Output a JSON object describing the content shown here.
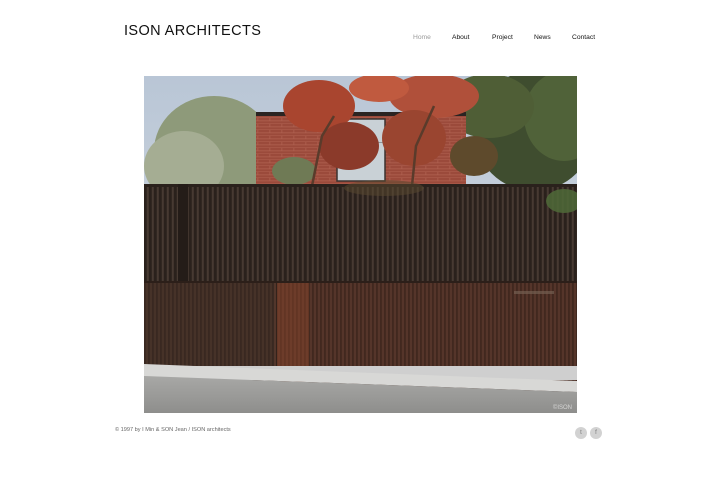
{
  "site": {
    "logo": "ISON ARCHITECTS"
  },
  "nav": {
    "items": [
      {
        "label": "Home",
        "active": true
      },
      {
        "label": "About",
        "active": false
      },
      {
        "label": "Project",
        "active": false
      },
      {
        "label": "News",
        "active": false
      },
      {
        "label": "Contact",
        "active": false
      }
    ]
  },
  "hero": {
    "alt": "Brick house behind a dark vertical-slat timber fence with red-leaved trees",
    "watermark": "©ISON"
  },
  "footer": {
    "copyright": "© 1997 by I Min & SON Jean / ISON architects",
    "social": [
      {
        "icon": "twitter-icon",
        "glyph": "t"
      },
      {
        "icon": "facebook-icon",
        "glyph": "f"
      }
    ]
  },
  "colors": {
    "background": "#ffffff",
    "text": "#111111",
    "nav_active": "#9a9a9a",
    "social_bg": "#d2d2d2"
  }
}
